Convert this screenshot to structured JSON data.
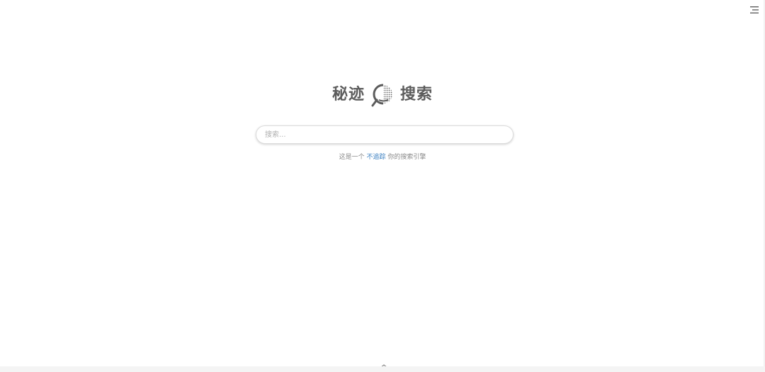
{
  "logo": {
    "left_text": "秘迹",
    "right_text": "搜索",
    "icon": "magnifier-logo-icon"
  },
  "search": {
    "placeholder": "搜索...",
    "value": ""
  },
  "tagline": {
    "prefix": "这是一个",
    "link": "不追踪",
    "suffix": "你的搜索引擎"
  },
  "icons": {
    "menu": "menu-icon",
    "scroll_up": "chevron-up-icon"
  },
  "colors": {
    "accent_link": "#3a7fc1",
    "logo_text": "#5c5c5c",
    "muted_text": "#8a8a8a"
  }
}
